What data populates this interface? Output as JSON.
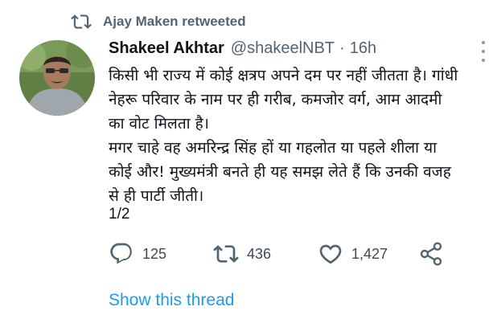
{
  "retweet": {
    "label": "Ajay Maken retweeted",
    "icon": "retweet-icon"
  },
  "tweet": {
    "author_name": "Shakeel Akhtar",
    "handle": "@shakeelNBT",
    "separator": "·",
    "time": "16h",
    "paragraphs": [
      "किसी भी राज्य में कोई क्षत्रप अपने दम पर नहीं जीतता है। गांधी\nनेहरू परिवार के नाम पर ही गरीब, कमजोर वर्ग, आम आदमी\nका वोट मिलता है।",
      "मगर चाहे वह अमरिन्द्र सिंह हों या गहलोत या पहले शीला या\nकोई और! मुख्यमंत्री बनते ही यह समझ लेते हैं कि उनकी वजह\nसे ही पार्टी जीती।"
    ],
    "thread_counter": "1/2"
  },
  "actions": {
    "reply": {
      "icon": "reply-icon",
      "count": "125"
    },
    "retweet": {
      "icon": "retweet-icon",
      "count": "436"
    },
    "like": {
      "icon": "heart-icon",
      "count": "1,427"
    },
    "share": {
      "icon": "share-icon"
    }
  },
  "show_thread_label": "Show this thread",
  "colors": {
    "accent": "#1d9bf0",
    "muted": "#536471",
    "text": "#0f1419"
  }
}
